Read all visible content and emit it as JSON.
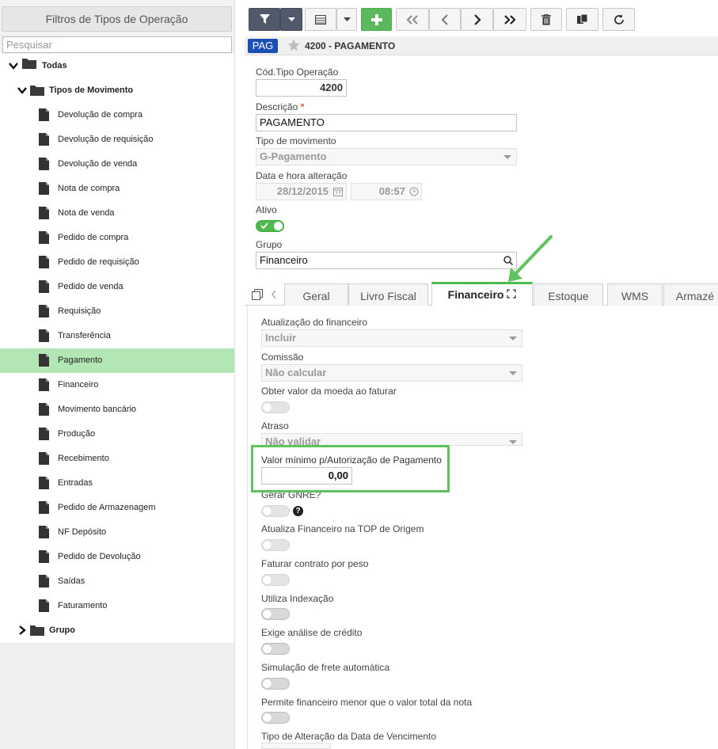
{
  "left_panel": {
    "title": "Filtros de Tipos de Operação",
    "search_placeholder": "Pesquisar",
    "tree": {
      "root": "Todas",
      "group_movimento": "Tipos de Movimento",
      "items": [
        "Devolução de compra",
        "Devolução de requisição",
        "Devolução de venda",
        "Nota de compra",
        "Nota de venda",
        "Pedido de compra",
        "Pedido de requisição",
        "Pedido de venda",
        "Requisição",
        "Transferência",
        "Pagamento",
        "Financeiro",
        "Movimento bancário",
        "Produção",
        "Recebimento",
        "Entradas",
        "Pedido de Armazenagem",
        "NF Depósito",
        "Pedido de Devolução",
        "Saídas",
        "Faturamento"
      ],
      "selected": "Pagamento",
      "group_grupo": "Grupo"
    }
  },
  "toolbar": {
    "buttons": [
      "filter-icon",
      "caret-down-icon",
      "grid-icon",
      "caret-down-icon",
      "plus-icon",
      "first-icon",
      "prev-icon",
      "next-icon",
      "last-icon",
      "trash-icon",
      "copy-icon",
      "refresh-icon"
    ]
  },
  "record": {
    "badge": "PAG",
    "title": "4200 - PAGAMENTO"
  },
  "form": {
    "cod_label": "Cód.Tipo Operação",
    "cod_value": "4200",
    "desc_label": "Descrição",
    "desc_required": "*",
    "desc_value": "PAGAMENTO",
    "tipo_label": "Tipo de movimento",
    "tipo_value": "G-Pagamento",
    "data_label": "Data e hora alteração",
    "data_value": "28/12/2015",
    "hora_value": "08:57",
    "ativo_label": "Ativo",
    "ativo_on": true,
    "grupo_label": "Grupo",
    "grupo_value": "Financeiro"
  },
  "tabs": [
    "Geral",
    "Livro Fiscal",
    "Financeiro",
    "Estoque",
    "WMS",
    "Armazé"
  ],
  "active_tab": "Financeiro",
  "financeiro": {
    "atualizacao_label": "Atualização do financeiro",
    "atualizacao_value": "Incluir",
    "comissao_label": "Comissão",
    "comissao_value": "Não calcular",
    "obter_label": "Obter valor da moeda ao faturar",
    "atraso_label": "Atraso",
    "atraso_value": "Não validar",
    "valor_min_label": "Valor mínimo p/Autorização de Pagamento",
    "valor_min_value": "0,00",
    "gnre_label": "Gerar GNRE?",
    "gnre_help": "?",
    "atualiza_top_label": "Atualiza Financeiro na TOP de Origem",
    "faturar_peso_label": "Faturar contrato por peso",
    "indexacao_label": "Utiliza Indexação",
    "credito_label": "Exige análise de crédito",
    "frete_label": "Simulação de frete automática",
    "menor_label": "Permite financeiro menor que o valor total da nota",
    "tipo_alt_label": "Tipo de Alteração da Data de Vencimento"
  },
  "colors": {
    "accent_green": "#5ec35e",
    "selected_row": "#b3e6b5",
    "badge_blue": "#1a4fb3",
    "toolbar_dark": "#505a6b"
  }
}
